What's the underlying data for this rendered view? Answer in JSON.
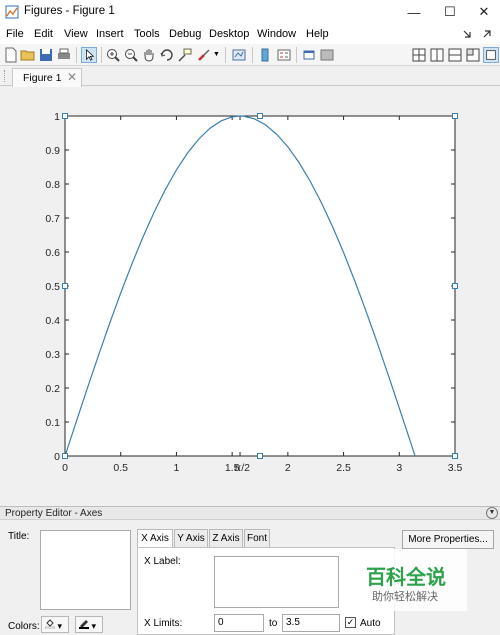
{
  "window": {
    "title": "Figures - Figure 1",
    "minimize_glyph": "—",
    "maximize_glyph": "☐",
    "close_glyph": "✕"
  },
  "menu": {
    "items": [
      "File",
      "Edit",
      "View",
      "Insert",
      "Tools",
      "Debug",
      "Desktop",
      "Window",
      "Help"
    ],
    "right_icons": [
      "dock-arrow-icon",
      "undock-icon"
    ]
  },
  "toolbar": {
    "icons": [
      "new-figure-icon",
      "open-file-icon",
      "save-icon",
      "print-icon",
      "edit-plot-pointer-icon",
      "zoom-in-icon",
      "zoom-out-icon",
      "pan-hand-icon",
      "rotate-3d-icon",
      "data-cursor-icon",
      "brush-icon",
      "link-plot-icon",
      "insert-colorbar-icon",
      "insert-legend-icon",
      "hide-plot-tools-icon",
      "show-plot-tools-icon",
      "tile-layout-icon",
      "vertical-split-icon",
      "horizontal-split-icon",
      "float-layout-icon",
      "maximize-layout-icon"
    ]
  },
  "tabs": [
    {
      "label": "Figure 1",
      "close_glyph": "✕"
    }
  ],
  "chart_data": {
    "type": "line",
    "function": "sin(x)",
    "x": [
      0,
      0.1,
      0.2,
      0.3,
      0.4,
      0.5,
      0.6,
      0.7,
      0.8,
      0.9,
      1.0,
      1.1,
      1.2,
      1.3,
      1.4,
      1.5,
      1.5708,
      1.6,
      1.7,
      1.8,
      1.9,
      2.0,
      2.1,
      2.2,
      2.3,
      2.4,
      2.5,
      2.6,
      2.7,
      2.8,
      2.9,
      3.0,
      3.1,
      3.1416
    ],
    "y": [
      0,
      0.0998,
      0.1987,
      0.2955,
      0.3894,
      0.4794,
      0.5646,
      0.6442,
      0.7174,
      0.7833,
      0.8415,
      0.8912,
      0.932,
      0.9636,
      0.9854,
      0.9975,
      1.0,
      0.9996,
      0.9917,
      0.9738,
      0.9463,
      0.9093,
      0.8632,
      0.8085,
      0.7457,
      0.6755,
      0.5985,
      0.5155,
      0.4274,
      0.335,
      0.2392,
      0.1411,
      0.0416,
      0
    ],
    "xlim": [
      0,
      3.5
    ],
    "ylim": [
      0,
      1
    ],
    "xticks": [
      0,
      0.5,
      1,
      1.5,
      2,
      2.5,
      3,
      3.5
    ],
    "xtick_labels": [
      "0",
      "0.5",
      "1",
      "1.5",
      "2",
      "2.5",
      "3",
      "3.5"
    ],
    "yticks": [
      0,
      0.1,
      0.2,
      0.3,
      0.4,
      0.5,
      0.6,
      0.7,
      0.8,
      0.9,
      1
    ],
    "ytick_labels": [
      "0",
      "0.1",
      "0.2",
      "0.3",
      "0.4",
      "0.5",
      "0.6",
      "0.7",
      "0.8",
      "0.9",
      "1"
    ],
    "extra_xtick": {
      "value": 1.5708,
      "label": "π/2"
    },
    "series_color": "#3a7fb0",
    "selection_handle_color": "#3a7fb0",
    "grid": false
  },
  "property_editor": {
    "header": "Property Editor - Axes",
    "title_label": "Title:",
    "colors_label": "Colors:",
    "sub_tabs": [
      "X Axis",
      "Y Axis",
      "Z Axis",
      "Font"
    ],
    "active_sub_tab": "X Axis",
    "x_label_label": "X Label:",
    "x_limits_label": "X Limits:",
    "x_limit_min": "0",
    "to_label": "to",
    "x_limit_max": "3.5",
    "auto_label": "Auto",
    "auto_checked": "✓",
    "more_properties_label": "More Properties..."
  },
  "watermark": {
    "main": "百科全说",
    "sub": "助你轻松解决"
  }
}
